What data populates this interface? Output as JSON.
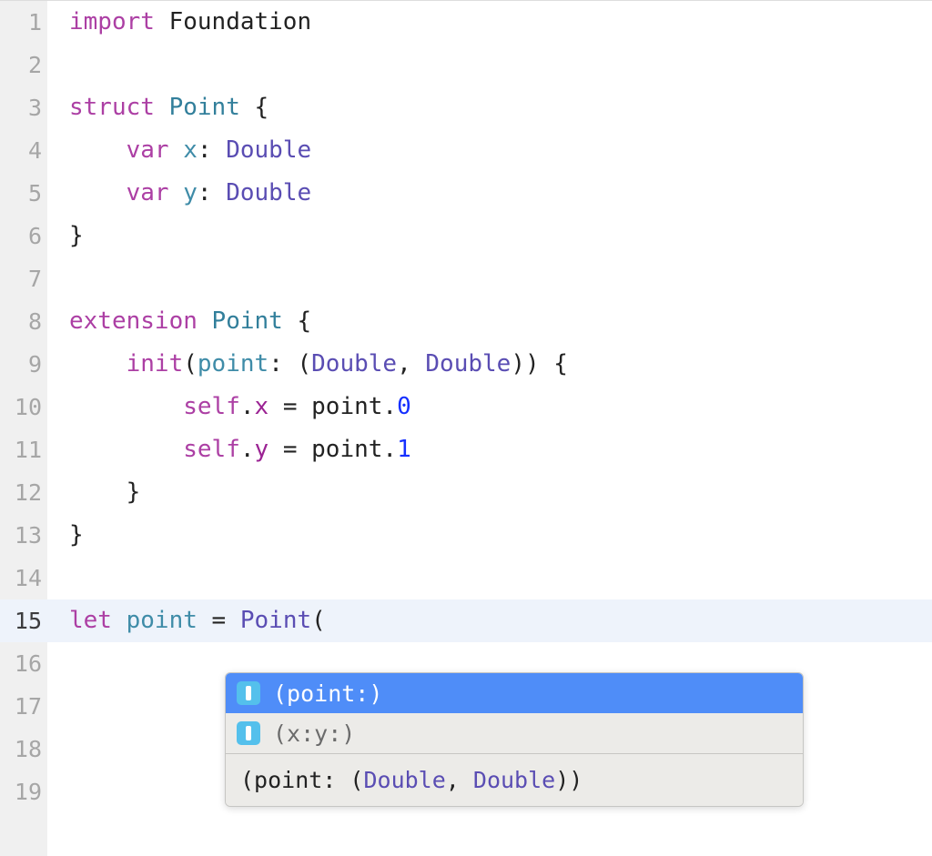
{
  "lines": [
    {
      "n": "1",
      "tokens": [
        {
          "t": "import ",
          "c": "kw"
        },
        {
          "t": "Foundation",
          "c": "ident"
        }
      ]
    },
    {
      "n": "2",
      "tokens": []
    },
    {
      "n": "3",
      "tokens": [
        {
          "t": "struct ",
          "c": "kw"
        },
        {
          "t": "Point",
          "c": "typ"
        },
        {
          "t": " {",
          "c": "ident"
        }
      ]
    },
    {
      "n": "4",
      "tokens": [
        {
          "t": "    ",
          "c": ""
        },
        {
          "t": "var ",
          "c": "kw"
        },
        {
          "t": "x",
          "c": "param"
        },
        {
          "t": ": ",
          "c": "ident"
        },
        {
          "t": "Double",
          "c": "typ-ref"
        }
      ]
    },
    {
      "n": "5",
      "tokens": [
        {
          "t": "    ",
          "c": ""
        },
        {
          "t": "var ",
          "c": "kw"
        },
        {
          "t": "y",
          "c": "param"
        },
        {
          "t": ": ",
          "c": "ident"
        },
        {
          "t": "Double",
          "c": "typ-ref"
        }
      ]
    },
    {
      "n": "6",
      "tokens": [
        {
          "t": "}",
          "c": "ident"
        }
      ]
    },
    {
      "n": "7",
      "tokens": []
    },
    {
      "n": "8",
      "tokens": [
        {
          "t": "extension ",
          "c": "kw"
        },
        {
          "t": "Point",
          "c": "typ"
        },
        {
          "t": " {",
          "c": "ident"
        }
      ]
    },
    {
      "n": "9",
      "tokens": [
        {
          "t": "    ",
          "c": ""
        },
        {
          "t": "init",
          "c": "kw"
        },
        {
          "t": "(",
          "c": "ident"
        },
        {
          "t": "point",
          "c": "param"
        },
        {
          "t": ": (",
          "c": "ident"
        },
        {
          "t": "Double",
          "c": "typ-ref"
        },
        {
          "t": ", ",
          "c": "ident"
        },
        {
          "t": "Double",
          "c": "typ-ref"
        },
        {
          "t": ")) {",
          "c": "ident"
        }
      ]
    },
    {
      "n": "10",
      "tokens": [
        {
          "t": "        ",
          "c": ""
        },
        {
          "t": "self",
          "c": "kw"
        },
        {
          "t": ".",
          "c": "ident"
        },
        {
          "t": "x",
          "c": "self-prop"
        },
        {
          "t": " = point.",
          "c": "ident"
        },
        {
          "t": "0",
          "c": "num-mem"
        }
      ]
    },
    {
      "n": "11",
      "tokens": [
        {
          "t": "        ",
          "c": ""
        },
        {
          "t": "self",
          "c": "kw"
        },
        {
          "t": ".",
          "c": "ident"
        },
        {
          "t": "y",
          "c": "self-prop"
        },
        {
          "t": " = point.",
          "c": "ident"
        },
        {
          "t": "1",
          "c": "num-mem"
        }
      ]
    },
    {
      "n": "12",
      "tokens": [
        {
          "t": "    }",
          "c": "ident"
        }
      ]
    },
    {
      "n": "13",
      "tokens": [
        {
          "t": "}",
          "c": "ident"
        }
      ]
    },
    {
      "n": "14",
      "tokens": []
    },
    {
      "n": "15",
      "current": true,
      "tokens": [
        {
          "t": "let ",
          "c": "kw"
        },
        {
          "t": "point",
          "c": "param"
        },
        {
          "t": " = ",
          "c": "ident"
        },
        {
          "t": "Point",
          "c": "typ-ref"
        },
        {
          "t": "(",
          "c": "ident"
        }
      ]
    },
    {
      "n": "16",
      "tokens": []
    },
    {
      "n": "17",
      "tokens": []
    },
    {
      "n": "18",
      "tokens": []
    },
    {
      "n": "19",
      "tokens": []
    }
  ],
  "autocomplete": {
    "items": [
      {
        "label": "(point:)",
        "selected": true
      },
      {
        "label": "(x:y:)",
        "selected": false
      }
    ],
    "detail": {
      "prefix": "(point: (",
      "t1": "Double",
      "mid": ", ",
      "t2": "Double",
      "suffix": "))"
    }
  }
}
